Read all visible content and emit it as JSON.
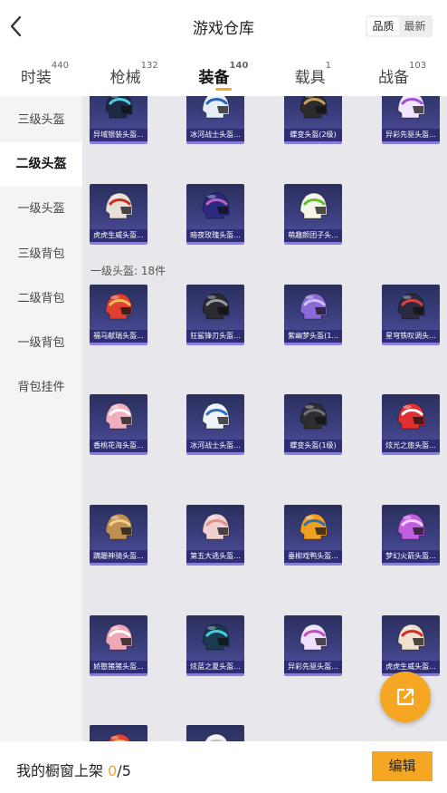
{
  "header": {
    "title": "游戏仓库",
    "sort_options": [
      "品质",
      "最新"
    ],
    "sort_selected": "品质"
  },
  "tabs": [
    {
      "label": "时装",
      "count": "440"
    },
    {
      "label": "枪械",
      "count": "132"
    },
    {
      "label": "装备",
      "count": "140",
      "active": true
    },
    {
      "label": "载具",
      "count": "1"
    },
    {
      "label": "战备",
      "count": "103"
    }
  ],
  "sidebar": {
    "items": [
      {
        "label": "三级头盔"
      },
      {
        "label": "二级头盔",
        "active": true
      },
      {
        "label": "一级头盔"
      },
      {
        "label": "三级背包"
      },
      {
        "label": "二级背包"
      },
      {
        "label": "一级背包"
      },
      {
        "label": "背包挂件"
      }
    ]
  },
  "sections": {
    "level1_header": "一级头盔: 18件"
  },
  "items_top": [
    {
      "name": "异域银装头盔...",
      "color": "#1d2a44",
      "accent": "#4fd0e0"
    },
    {
      "name": "冰河战士头盔...",
      "color": "#e8eef8",
      "accent": "#2a64c0"
    },
    {
      "name": "蝶变头盔(2级)",
      "color": "#2b2b2b",
      "accent": "#c8a060"
    },
    {
      "name": "异彩先驱头盔...",
      "color": "#f2e6ff",
      "accent": "#a050e0"
    },
    {
      "name": "虎虎生威头盔...",
      "color": "#e8e0d8",
      "accent": "#c83020"
    },
    {
      "name": "暗夜玫瑰头盔...",
      "color": "#2a2a80",
      "accent": "#c060c0"
    },
    {
      "name": "萌趣颜团子头...",
      "color": "#f5f5e8",
      "accent": "#60c030"
    }
  ],
  "items_level1": [
    {
      "name": "福马献瑞头盔...",
      "color": "#e04030",
      "accent": "#f0c060"
    },
    {
      "name": "狂鲨锋刃头盔...",
      "color": "#2a2a30",
      "accent": "#9a9aa8"
    },
    {
      "name": "紫幽梦头盔(1...",
      "color": "#8a6ad8",
      "accent": "#d0c0ff"
    },
    {
      "name": "星穹铁叹调头...",
      "color": "#2a2a40",
      "accent": "#e04040"
    },
    {
      "name": "香桃花海头盔...",
      "color": "#f0b0c0",
      "accent": "#ffffff"
    },
    {
      "name": "冰河战士头盔...",
      "color": "#f0f4f8",
      "accent": "#3070c0"
    },
    {
      "name": "蝶变头盔(1级)",
      "color": "#2e2e30",
      "accent": "#707078"
    },
    {
      "name": "炫光之旅头盔...",
      "color": "#e03030",
      "accent": "#ffffff"
    },
    {
      "name": "蹒跚神骑头盔...",
      "color": "#c09050",
      "accent": "#f0d090"
    },
    {
      "name": "第五大逃头盔...",
      "color": "#f0d0d0",
      "accent": "#e09090"
    },
    {
      "name": "垂柳戏鸭头盔...",
      "color": "#f0a020",
      "accent": "#3070b0"
    },
    {
      "name": "梦幻火箭头盔...",
      "color": "#c060e0",
      "accent": "#f0d0ff"
    },
    {
      "name": "娇憨猪猪头盔...",
      "color": "#f0a8b8",
      "accent": "#ffffff"
    },
    {
      "name": "炫蓝之夏头盔...",
      "color": "#1a3a50",
      "accent": "#40d0e0"
    },
    {
      "name": "异彩先驱头盔...",
      "color": "#f0e0ff",
      "accent": "#c050c0"
    },
    {
      "name": "虎虎生威头盔...",
      "color": "#f0e0d0",
      "accent": "#d03020"
    },
    {
      "name": "",
      "color": "#e04030",
      "accent": "#f0c060"
    },
    {
      "name": "",
      "color": "#f0f0f0",
      "accent": "#c0c0c0"
    }
  ],
  "bottom": {
    "shelf_label": "我的橱窗上架",
    "shelf_count": "0",
    "shelf_total": "/5",
    "edit_label": "编辑"
  },
  "icons": {
    "back": "chevron-left-icon",
    "fab": "share-external-icon"
  },
  "colors": {
    "accent": "#f5a623",
    "sidebar_bg": "#f4f4f6",
    "content_bg": "#e8e8ec",
    "card_bg": "#3b3f7e"
  }
}
